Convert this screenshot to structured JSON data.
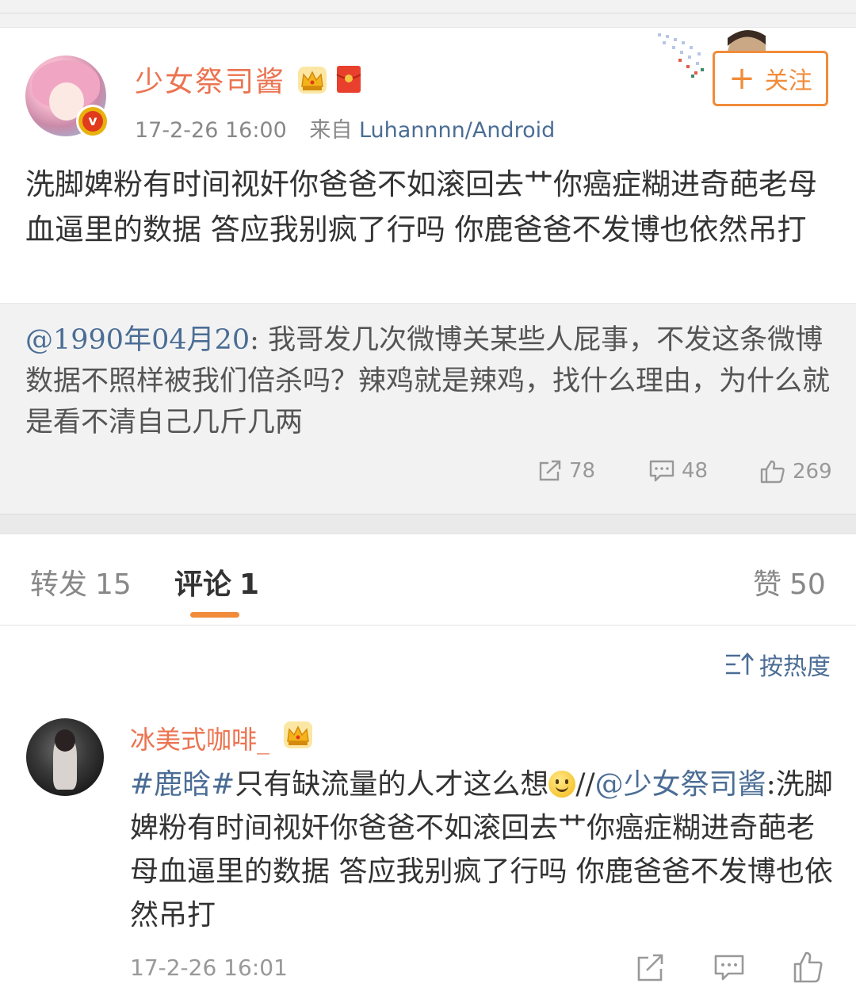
{
  "post": {
    "username": "少女祭司酱",
    "timestamp": "17-2-26 16:00",
    "source_prefix": "来自",
    "source": "Luhannnn/Android",
    "follow_label": "关注",
    "follow_plus": "+",
    "verified_mark": "v",
    "text": "洗脚婢粉有时间视奸你爸爸不如滚回去艹你癌症糊进奇葩老母血逼里的数据 答应我别疯了行吗 你鹿爸爸不发博也依然吊打"
  },
  "repost": {
    "mention": "@1990年04月20",
    "text": ": 我哥发几次微博关某些人屁事，不发这条微博数据不照样被我们倍杀吗？辣鸡就是辣鸡，找什么理由，为什么就是看不清自己几斤几两",
    "stats": {
      "reposts": "78",
      "comments": "48",
      "likes": "269"
    }
  },
  "tabs": [
    {
      "label": "转发",
      "count": "15"
    },
    {
      "label": "评论",
      "count": "1"
    },
    {
      "label": "赞",
      "count": "50"
    }
  ],
  "sort_label": "按热度",
  "comment": {
    "username": "冰美式咖啡_",
    "hashtag": "#鹿晗#",
    "text_part1": "只有缺流量的人才这么想",
    "separator": "//",
    "mention": "@少女祭司酱",
    "text_part2": ":洗脚婢粉有时间视奸你爸爸不如滚回去艹你癌症糊进奇葩老母血逼里的数据 答应我别疯了行吗 你鹿爸爸不发博也依然吊打",
    "timestamp": "17-2-26 16:01"
  },
  "colors": {
    "accent": "#f08c3a",
    "username": "#eb7350",
    "link": "#4b6d95"
  },
  "icons": [
    "crown-icon",
    "red-packet-icon",
    "share-icon",
    "comment-icon",
    "like-icon",
    "sort-icon",
    "smile-emoji"
  ]
}
